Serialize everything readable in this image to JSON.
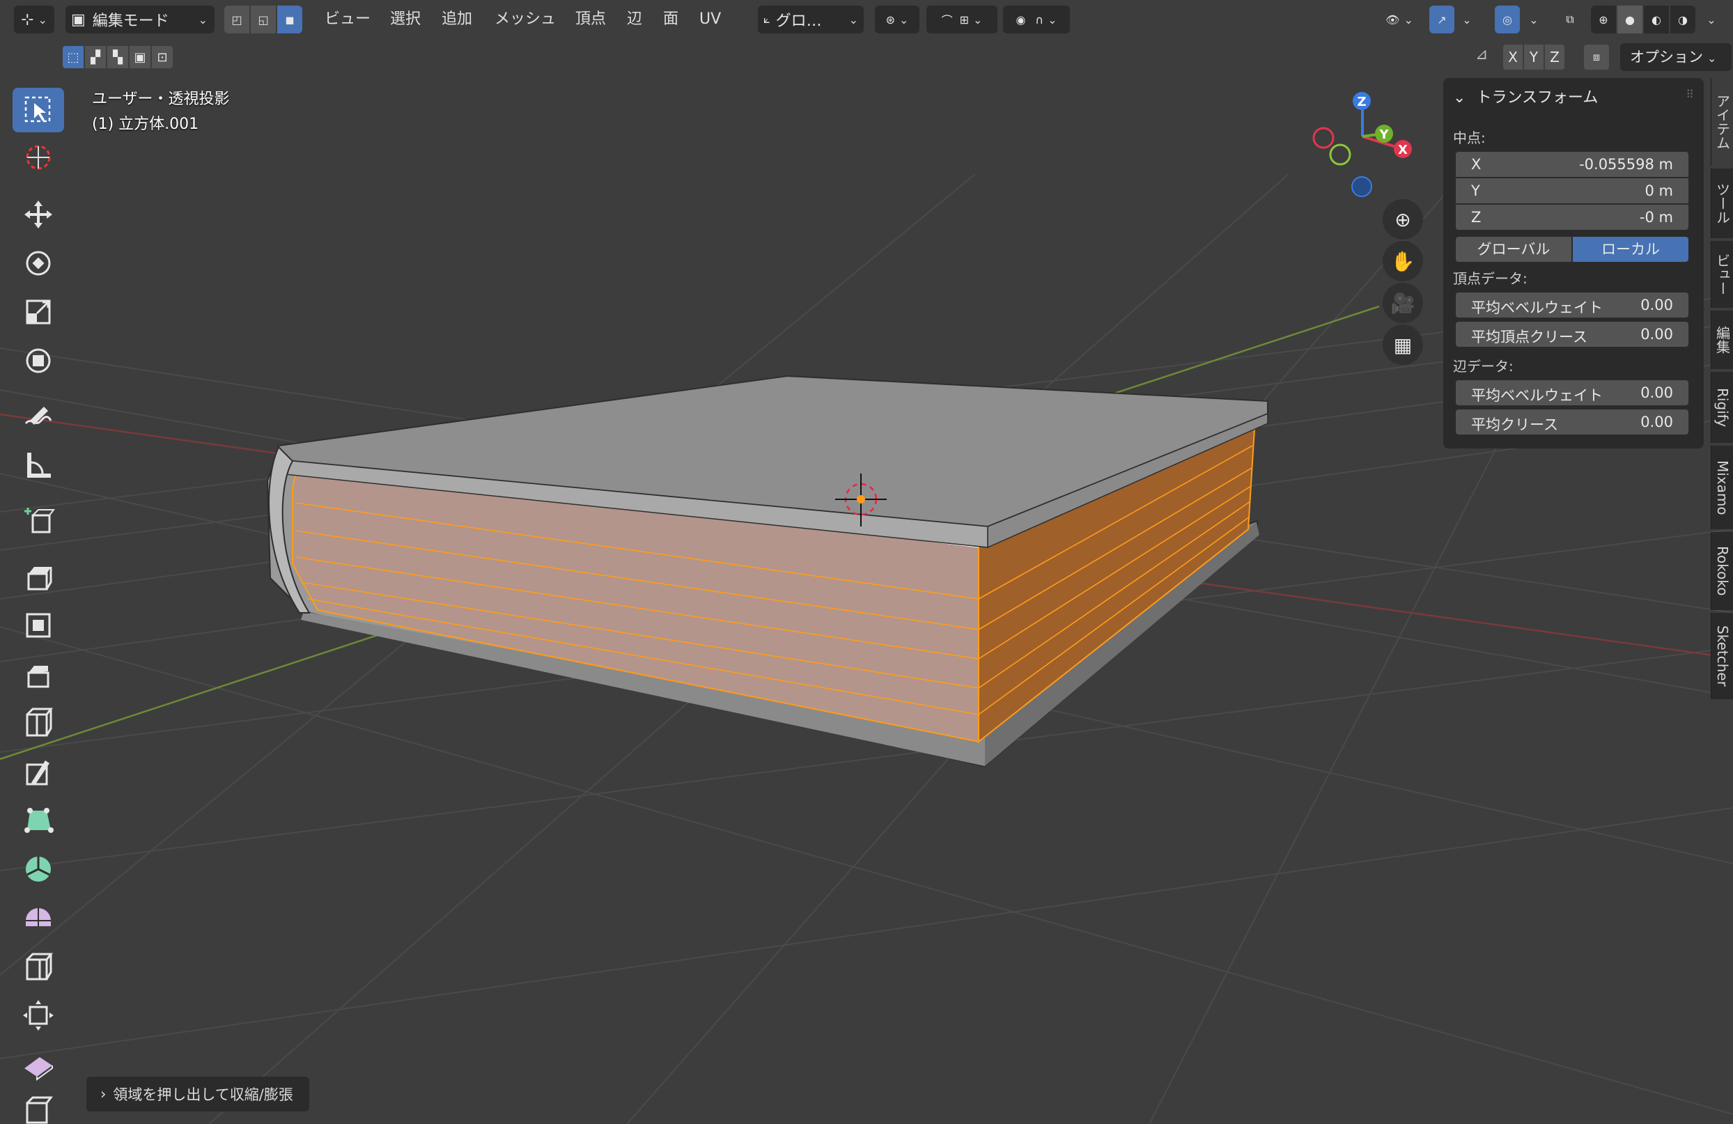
{
  "header": {
    "mode": "編集モード",
    "menus": [
      "ビュー",
      "選択",
      "追加",
      "メッシュ",
      "頂点",
      "辺",
      "面",
      "UV"
    ],
    "transform_orientation": "グロ…",
    "options_label": "オプション",
    "axis_x": "X",
    "axis_y": "Y",
    "axis_z": "Z"
  },
  "viewport": {
    "view_name": "ユーザー・透視投影",
    "object_name": "(1) 立方体.001",
    "operator_panel": "領域を押し出して収縮/膨張",
    "gizmo": {
      "x": "X",
      "y": "Y",
      "z": "Z"
    }
  },
  "npanel": {
    "title": "トランスフォーム",
    "median_label": "中点:",
    "x_label": "X",
    "x_value": "-0.055598 m",
    "y_label": "Y",
    "y_value": "0 m",
    "z_label": "Z",
    "z_value": "-0 m",
    "global_label": "グローバル",
    "local_label": "ローカル",
    "vertex_data_label": "頂点データ:",
    "v_bevel_label": "平均ベベルウェイト",
    "v_bevel_value": "0.00",
    "v_crease_label": "平均頂点クリース",
    "v_crease_value": "0.00",
    "edge_data_label": "辺データ:",
    "e_bevel_label": "平均ベベルウェイト",
    "e_bevel_value": "0.00",
    "e_crease_label": "平均クリース",
    "e_crease_value": "0.00"
  },
  "tabs": [
    "アイテム",
    "ツール",
    "ビュー",
    "編集",
    "Rigify",
    "Mixamo",
    "Rokoko",
    "Sketcher"
  ],
  "colors": {
    "accent": "#4772b3",
    "selection": "#ff8c00",
    "background": "#3d3d3d"
  }
}
